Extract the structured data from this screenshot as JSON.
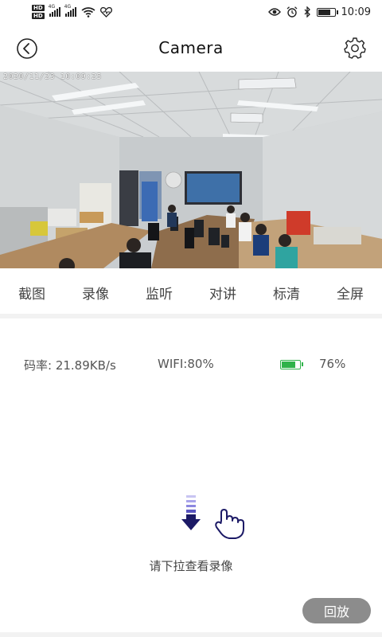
{
  "status_bar": {
    "hd_top": "HD",
    "hd_bottom": "HD",
    "network_1": "4G",
    "network_2": "4G",
    "battery_level_percent": 80,
    "time": "10:09",
    "icons": [
      "hd-icon",
      "signal-icon",
      "wifi-icon",
      "heart-icon",
      "eye-icon",
      "alarm-icon",
      "bluetooth-icon",
      "battery-icon"
    ]
  },
  "header": {
    "title": "Camera",
    "back_icon": "back-circle-icon",
    "settings_icon": "gear-icon"
  },
  "video": {
    "timestamp": "2020/11/23 10:09:25"
  },
  "toolbar": {
    "items": [
      "截图",
      "录像",
      "监听",
      "对讲",
      "标清",
      "全屏"
    ]
  },
  "stats": {
    "bitrate": "码率:  21.89KB/s",
    "wifi": "WIFI:80%",
    "battery_percent_text": "76%",
    "battery_level_percent": 76,
    "battery_color": "#2fb24a"
  },
  "hint": {
    "text": "请下拉查看录像",
    "arrow_color": "#1c1a66",
    "arrow_fade_color": "#8c87e0"
  },
  "playback": {
    "label": "回放",
    "color": "#8c8c8c"
  }
}
